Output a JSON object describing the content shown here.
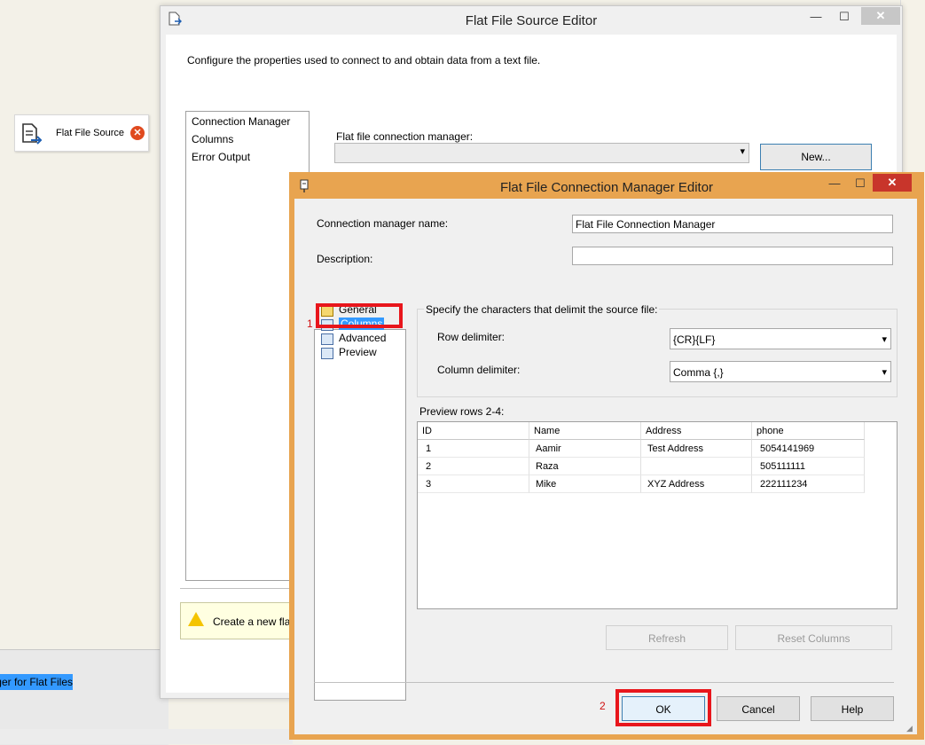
{
  "designer": {
    "component_label": "Flat File Source",
    "bottom_tab_label": "ger for Flat Files"
  },
  "outer_dialog": {
    "title": "Flat File Source Editor",
    "description": "Configure the properties used to connect to and obtain data from a text file.",
    "nav_items": [
      "Connection Manager",
      "Columns",
      "Error Output"
    ],
    "connection_manager_label": "Flat file connection manager:",
    "connection_manager_value": "",
    "new_button": "New...",
    "hint_text": "Create a new flat"
  },
  "inner_dialog": {
    "title": "Flat File Connection Manager Editor",
    "name_label": "Connection manager name:",
    "name_value": "Flat File Connection Manager",
    "description_label": "Description:",
    "description_value": "",
    "nav_items": [
      {
        "label": "General",
        "icon": "general-icon"
      },
      {
        "label": "Columns",
        "icon": "columns-icon",
        "selected": true
      },
      {
        "label": "Advanced",
        "icon": "advanced-icon"
      },
      {
        "label": "Preview",
        "icon": "preview-icon"
      }
    ],
    "delimit_group_title": "Specify the characters that delimit the source file:",
    "row_delimiter_label": "Row delimiter:",
    "row_delimiter_value": "{CR}{LF}",
    "column_delimiter_label": "Column delimiter:",
    "column_delimiter_value": "Comma {,}",
    "preview_label": "Preview rows 2-4:",
    "grid": {
      "columns": [
        "ID",
        "Name",
        "Address",
        "phone"
      ],
      "rows": [
        [
          "1",
          "Aamir",
          "Test Address",
          "5054141969"
        ],
        [
          "2",
          "Raza",
          "",
          "505111111"
        ],
        [
          "3",
          "Mike",
          "XYZ Address",
          "222111234"
        ]
      ]
    },
    "refresh_button": "Refresh",
    "reset_columns_button": "Reset Columns",
    "ok_button": "OK",
    "cancel_button": "Cancel",
    "help_button": "Help",
    "annotation_1": "1",
    "annotation_2": "2"
  },
  "colors": {
    "inner_frame": "#e8a450",
    "selection": "#3399ff",
    "annotation_red": "#e8161c"
  }
}
